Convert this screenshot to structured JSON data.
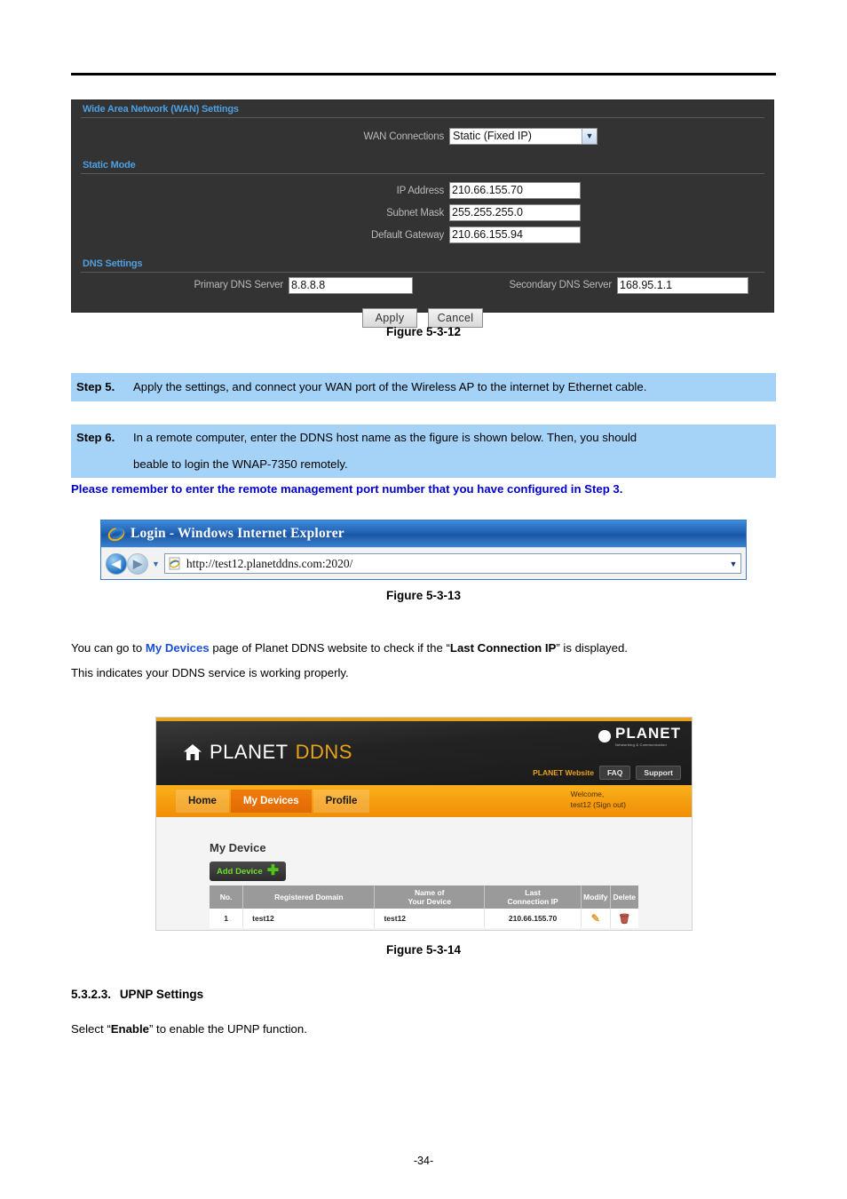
{
  "page": {
    "number": "-34-"
  },
  "wan_panel": {
    "title": "Wide Area Network (WAN) Settings",
    "wan_connections_label": "WAN Connections",
    "wan_connections_value": "Static (Fixed IP)",
    "static_mode_title": "Static Mode",
    "fields": [
      {
        "label": "IP Address",
        "value": "210.66.155.70"
      },
      {
        "label": "Subnet Mask",
        "value": "255.255.255.0"
      },
      {
        "label": "Default Gateway",
        "value": "210.66.155.94"
      }
    ],
    "dns_title": "DNS Settings",
    "primary_dns_label": "Primary DNS Server",
    "primary_dns_value": "8.8.8.8",
    "secondary_dns_label": "Secondary DNS Server",
    "secondary_dns_value": "168.95.1.1",
    "apply_label": "Apply",
    "cancel_label": "Cancel",
    "colors": {
      "panel_bg": "#333333",
      "section_title": "#4f9fe0",
      "label": "#b9b9b9"
    }
  },
  "figures": {
    "fig_12": "Figure 5-3-12",
    "fig_13": "Figure 5-3-13",
    "fig_14": "Figure 5-3-14"
  },
  "steps": [
    {
      "number": "Step 5.",
      "text": "Apply the settings, and connect your WAN port of the Wireless AP to the internet by Ethernet cable.",
      "line2": ""
    },
    {
      "number": "Step 6.",
      "text": "In a remote computer, enter the DDNS host name as the figure is shown below. Then, you should",
      "line2": "beable to login the WNAP-7350 remotely."
    }
  ],
  "note": "Please remember to enter the remote management port number that you have configured in Step 3.",
  "ie_window": {
    "title": "Login - Windows Internet Explorer",
    "url": "http://test12.planetddns.com:2020/",
    "back_label": "◀",
    "forward_label": "▶",
    "dropdown_label": "▼",
    "caret_label": "⌄"
  },
  "paragraph": {
    "part1": "You can go to ",
    "link": "My Devices",
    "part2": " page of Planet DDNS website to check if the “",
    "bold": "Last Connection IP",
    "part3": "” is displayed.",
    "line2": "This indicates your DDNS service is working properly."
  },
  "ddns_site": {
    "brand_planet": "PLANET",
    "brand_ddns": "DDNS",
    "logo_name": "PLANET",
    "logo_tagline": "Networking & Communication",
    "header_links": {
      "website": "PLANET Website",
      "faq": "FAQ",
      "support": "Support"
    },
    "nav_tabs": [
      {
        "label": "Home",
        "active": false
      },
      {
        "label": "My Devices",
        "active": true
      },
      {
        "label": "Profile",
        "active": false
      }
    ],
    "welcome_line1": "Welcome,",
    "welcome_line2": "test12  (Sign out)",
    "my_device_title": "My Device",
    "add_device_label": "Add Device",
    "table": {
      "headers": [
        "No.",
        "Registered Domain",
        "Name of\nYour Device",
        "Last\nConnection IP",
        "Modify",
        "Delete"
      ],
      "header_no": "No.",
      "header_domain": "Registered Domain",
      "header_name_l1": "Name of",
      "header_name_l2": "Your Device",
      "header_ip_l1": "Last",
      "header_ip_l2": "Connection IP",
      "header_modify": "Modify",
      "header_delete": "Delete",
      "rows": [
        {
          "no": "1",
          "domain": "test12",
          "device_name": "test12",
          "last_ip": "210.66.155.70"
        }
      ]
    },
    "colors": {
      "accent_orange": "#e8a21b",
      "nav_bar": "#f59c10",
      "header_dark": "#232323"
    }
  },
  "section": {
    "heading_number": "5.3.2.3.",
    "heading_title": "UPNP Settings",
    "body_part1": "Select “",
    "body_bold": "Enable",
    "body_part2": "” to enable the UPNP function."
  }
}
